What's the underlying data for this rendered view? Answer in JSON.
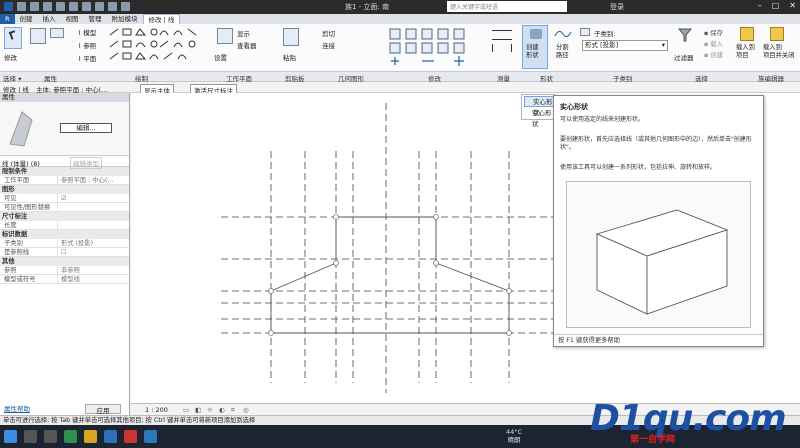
{
  "window": {
    "title": "族1 - 立面: 南",
    "search_placeholder": "键入关键字或短语",
    "login": "登录",
    "controls": [
      "–",
      "□",
      "✕"
    ]
  },
  "tabs": [
    "创建",
    "插入",
    "视图",
    "管理",
    "附加模块",
    "修改 | 线"
  ],
  "active_tab": "修改 | 线",
  "ribbon": {
    "modify_label": "修改",
    "model_line": "模型",
    "ref_line": "参照",
    "plane_line": "平面",
    "set_label": "设置",
    "show_label": "显示",
    "viewer_label": "查看器",
    "paste_label": "粘贴",
    "cut_label": "剪切",
    "join_label": "连接",
    "create_form_label": "创建\n形状",
    "split_path_label": "分割\n路径",
    "subcategory_label": "子类别:",
    "subcategory_value": "形式 [投影]",
    "filter_label": "过滤器",
    "save_label": "保存",
    "load_label": "载入",
    "create_label": "创建",
    "load_project_label": "载入到\n项目",
    "load_project_close_label": "载入到\n项目并关闭"
  },
  "group_labels": [
    "选择 ▾",
    "属性",
    "绘制",
    "工作平面",
    "剪贴板",
    "几何图形",
    "修改",
    "测量",
    "形状",
    "子类别",
    "选择",
    "族编辑器"
  ],
  "options_bar": {
    "mode": "修改 | 线",
    "host_label": "主体: 参照平面 : 中心(...",
    "show_host": "显示主体",
    "temp_dims": "激活尺寸标注"
  },
  "properties": {
    "header": "属性",
    "type_selector": "线 (体量) (8)",
    "edit_type": "编辑类型",
    "sections": [
      {
        "title": "限制条件",
        "rows": [
          {
            "k": "工作平面",
            "v": "参照平面 : 中心(..."
          }
        ]
      },
      {
        "title": "图形",
        "rows": [
          {
            "k": "可见",
            "v": "☑"
          },
          {
            "k": "可见性/图形替换",
            "v": ""
          }
        ]
      },
      {
        "title": "尺寸标注",
        "rows": [
          {
            "k": "长度",
            "v": ""
          }
        ]
      },
      {
        "title": "标识数据",
        "rows": [
          {
            "k": "子类别",
            "v": "形式 (投影)"
          },
          {
            "k": "是参照线",
            "v": "☐"
          }
        ]
      },
      {
        "title": "其他",
        "rows": [
          {
            "k": "参照",
            "v": "非参照"
          },
          {
            "k": "模型或符号",
            "v": "模型线"
          }
        ]
      }
    ],
    "edit_popup": "编辑...",
    "help_link": "属性帮助",
    "apply_button": "应用"
  },
  "dropdown": {
    "items": [
      "实心形状",
      "空心形状"
    ],
    "selected": "实心形状"
  },
  "tooltip": {
    "title": "实心形状",
    "desc1": "可以使用选定的线来创建形状。",
    "desc2": "要创建形状，首先应选择线（或其他几何图形中的边），然后单击\"创建形状\"。",
    "desc3": "使用该工具可以创建一系列形状，包括拉伸、旋转和放样。",
    "footer": "按 F1 键获得更多帮助"
  },
  "view_bar": {
    "scale": "1 : 200"
  },
  "status_bar": "单击可进行选择; 按 Tab 键并单击可选择其他项目; 按 Ctrl 键并单击可将新项目添加到选择",
  "taskbar": {
    "weather_temp": "44°C",
    "weather_text": "晴朗"
  },
  "watermark": {
    "logo": "D1qu.com",
    "sub": "第一自学网"
  },
  "colors": {
    "app_tab": "#1f5fa8",
    "accent_blue": "#1d4fa3",
    "titlebar": "#2b2b2b",
    "taskbar": "#1c2431"
  }
}
